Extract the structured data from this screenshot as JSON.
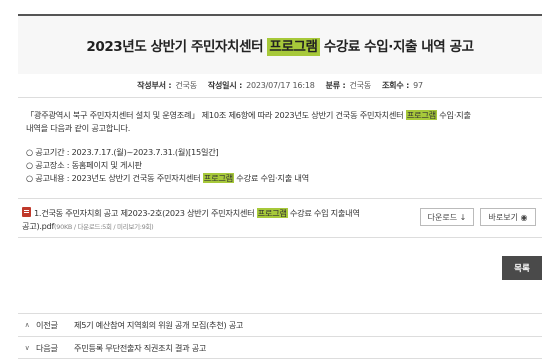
{
  "post": {
    "title_before": "2023년도 상반기 주민자치센터 ",
    "title_highlight": "프로그램",
    "title_after": " 수강료 수입·지출 내역 공고"
  },
  "meta": {
    "author_label": "작성부서 :",
    "author": "건국동",
    "date_label": "작성일시 :",
    "date": "2023/07/17 16:18",
    "category_label": "분류 :",
    "category": "건국동",
    "views_label": "조회수 :",
    "views": "97"
  },
  "body": {
    "intro_line1_a": "「광주광역시 북구 주민자치센터 설치 및 운영조례」 제10조 제6항에 따라 2023년도 상반기 건국동 주민자치센터 ",
    "intro_line1_hl": "프로그램",
    "intro_line1_b": " 수입·지출",
    "intro_line2": "내역을 다음과 같이 공고합니다.",
    "period": "○ 공고기간 : 2023.7.17.(월)~2023.7.31.(월)[15일간]",
    "place": "○ 공고장소 : 동홈페이지 및 게시판",
    "content_a": "○ 공고내용 : 2023년도 상반기 건국동 주민자치센터 ",
    "content_hl": "프로그램",
    "content_b": " 수강료 수입·지출 내역"
  },
  "attachment": {
    "name_a": "1.건국동 주민자치회 공고 제2023-2호(2023 상반기 주민자치센터 ",
    "name_hl": "프로그램",
    "name_b": " 수강료 수입 지출내역",
    "name_c": "공고).pdf",
    "info": "(90KB / 다운로드:5회 / 미리보기:9회)",
    "download_label": "다운로드 ↓",
    "preview_label": "바로보기 ◉"
  },
  "actions": {
    "list_label": "목록"
  },
  "navigation": {
    "prev_arrow": "∧",
    "prev_label": "이전글",
    "prev_title": "제5기 예산참여 지역회의 위원 공개 모집(추천) 공고",
    "next_arrow": "∨",
    "next_label": "다음글",
    "next_title": "주민등록 무단전출자 직권조치 결과 공고"
  },
  "colors": {
    "highlight": "#a7c93a",
    "list_button": "#4a4a4a",
    "file_icon": "#c0392b"
  }
}
